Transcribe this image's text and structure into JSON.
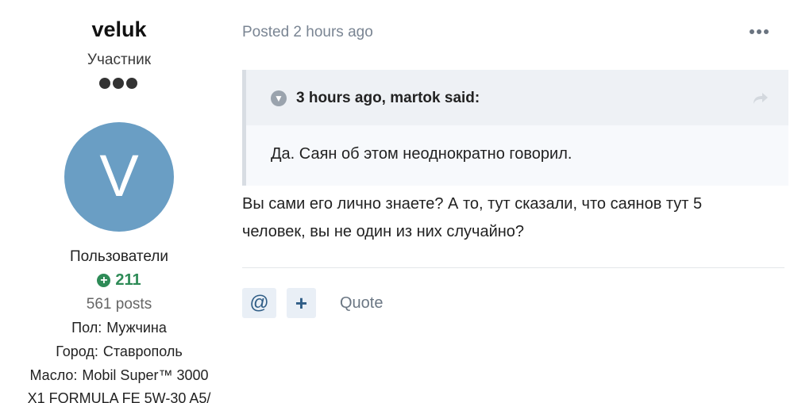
{
  "author": {
    "name": "veluk",
    "rank": "Участник",
    "avatar_letter": "V",
    "group": "Пользователи",
    "reputation": "211",
    "posts": "561 posts",
    "fields": [
      {
        "key": "Пол:",
        "value": "Мужчина"
      },
      {
        "key": "Город:",
        "value": "Ставрополь"
      },
      {
        "key": "Масло:",
        "value": "Mobil Super™ 3000"
      },
      {
        "key": "",
        "value": "X1 FORMULA FE 5W-30 A5/"
      }
    ]
  },
  "post": {
    "meta": "Posted 2 hours ago",
    "quote": {
      "citation": "3 hours ago, martok said:",
      "text": "Да. Саян об этом неоднократно говорил."
    },
    "text_line1": "Вы сами его лично знаете? А то, тут сказали, что саянов тут 5",
    "text_line2": "человек, вы не один из них случайно?"
  },
  "actions": {
    "mention_glyph": "@",
    "multiquote_glyph": "+",
    "quote_label": "Quote"
  },
  "colors": {
    "avatar": "#6a9ec4",
    "reputation": "#2e8b57",
    "button_bg": "#e9eff6",
    "button_fg": "#2f5d86"
  }
}
